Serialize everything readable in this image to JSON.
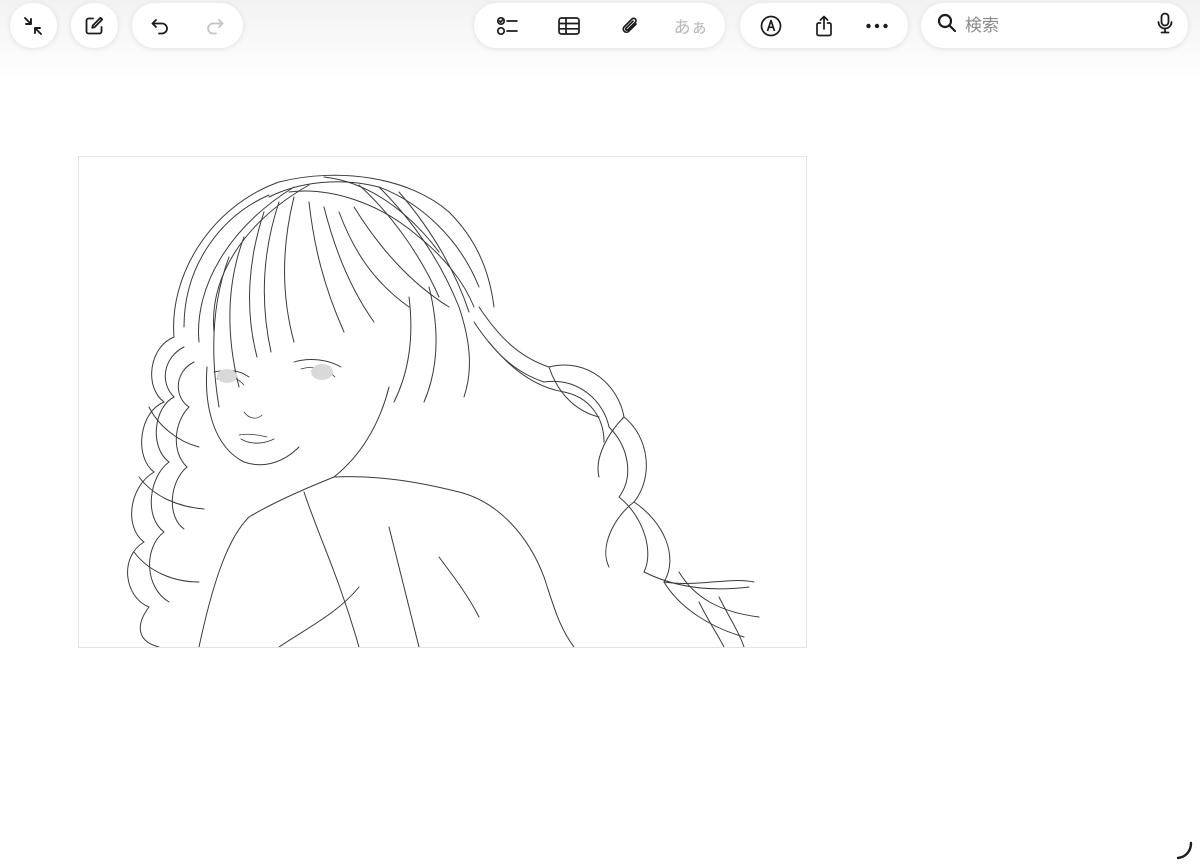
{
  "toolbar": {
    "left_buttons": [
      {
        "icon": "collapse-arrows-icon"
      },
      {
        "icon": "compose-note-icon"
      }
    ],
    "undo_redo": [
      {
        "icon": "undo-icon",
        "enabled": true
      },
      {
        "icon": "redo-icon",
        "enabled": false
      }
    ],
    "format_group": {
      "checklist_icon": "checklist-icon",
      "table_icon": "table-icon",
      "attachment_icon": "paperclip-icon",
      "text_format_label": "あぁ"
    },
    "actions_group": {
      "markup_icon": "markup-pen-icon",
      "share_icon": "share-icon",
      "more_icon": "ellipsis-icon"
    },
    "search": {
      "placeholder": "検索",
      "value": "",
      "search_icon": "search-icon",
      "mic_icon": "microphone-icon"
    }
  },
  "note": {
    "content": "sketch-drawing",
    "eye_shade_color": "#d9d9d9"
  },
  "colors": {
    "icon": "#1c1c1e",
    "icon_disabled": "#c4c4c4",
    "line_art": "#3a3a3a"
  }
}
